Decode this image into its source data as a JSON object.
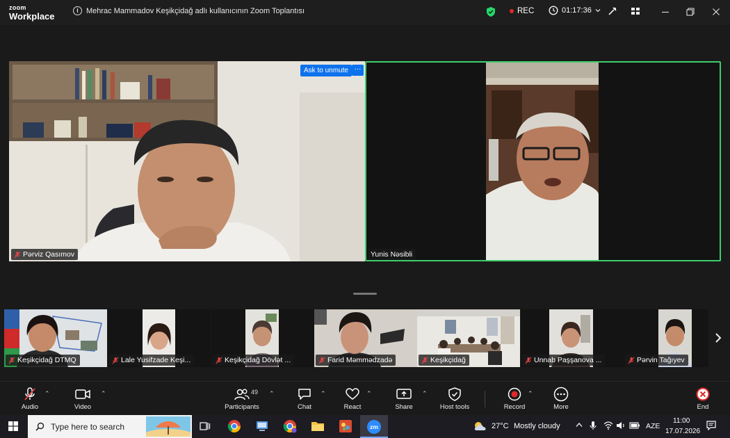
{
  "app": {
    "logo_line1": "zoom",
    "logo_line2": "Workplace",
    "meeting_title": "Mehrac Mammadov Keşikçidağ adlı kullanıcının Zoom Toplantısı",
    "rec_label": "REC",
    "timer": "01:17:36"
  },
  "main_videos": [
    {
      "name": "Pərviz Qasımov"
    },
    {
      "name": "Yunis Nəsibli"
    }
  ],
  "ask_unmute_label": "Ask to unmute",
  "more_dots": "···",
  "gallery": [
    {
      "name": "Keşikçidağ DTMQ"
    },
    {
      "name": "Lale Yusifzade Keşi..."
    },
    {
      "name": "Keşikçidağ Dövlət ..."
    },
    {
      "name": "Farid Məmmədzadə"
    },
    {
      "name": "Keşikçidağ"
    },
    {
      "name": "Unnab Paşşanova ..."
    },
    {
      "name": "Pərvin Tağıyev"
    }
  ],
  "toolbar": {
    "audio": "Audio",
    "video": "Video",
    "participants": "Participants",
    "participants_count": "49",
    "chat": "Chat",
    "react": "React",
    "share": "Share",
    "host_tools": "Host tools",
    "record": "Record",
    "more": "More",
    "end": "End"
  },
  "taskbar": {
    "search_placeholder": "Type here to search",
    "weather_temp": "27°C",
    "weather_desc": "Mostly cloudy",
    "lang": "AZE",
    "time": "11:00",
    "date": "17.07.2026",
    "zoom_app_label": "zm"
  },
  "colors": {
    "active_speaker_border": "#3ecf6c",
    "accent_blue": "#0e72ed",
    "record_red": "#e02828"
  }
}
